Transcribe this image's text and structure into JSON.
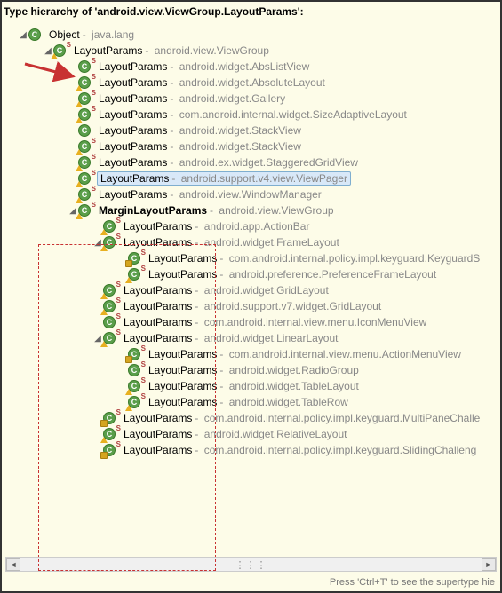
{
  "header": "Type hierarchy of 'android.view.ViewGroup.LayoutParams':",
  "footer_hint": "Press 'Ctrl+T' to see the supertype hie",
  "selected_index": 9,
  "bold_index": 11,
  "nodes": [
    {
      "indent": 0,
      "exp": "down",
      "icon": "class",
      "overlay": "",
      "name": "Object",
      "pkg": "java.lang"
    },
    {
      "indent": 1,
      "exp": "down",
      "icon": "class",
      "overlay": "warn",
      "badge": "S",
      "name": "LayoutParams",
      "pkg": "android.view.ViewGroup"
    },
    {
      "indent": 2,
      "exp": "none",
      "icon": "class",
      "overlay": "",
      "badge": "S",
      "name": "LayoutParams",
      "pkg": "android.widget.AbsListView"
    },
    {
      "indent": 2,
      "exp": "none",
      "icon": "class",
      "overlay": "warn",
      "badge": "S",
      "name": "LayoutParams",
      "pkg": "android.widget.AbsoluteLayout"
    },
    {
      "indent": 2,
      "exp": "none",
      "icon": "class",
      "overlay": "warn",
      "badge": "S",
      "name": "LayoutParams",
      "pkg": "android.widget.Gallery"
    },
    {
      "indent": 2,
      "exp": "none",
      "icon": "class",
      "overlay": "warn",
      "badge": "S",
      "name": "LayoutParams",
      "pkg": "com.android.internal.widget.SizeAdaptiveLayout"
    },
    {
      "indent": 2,
      "exp": "none",
      "icon": "class",
      "overlay": "",
      "badge": "",
      "name": "LayoutParams",
      "pkg": "android.widget.StackView"
    },
    {
      "indent": 2,
      "exp": "none",
      "icon": "class",
      "overlay": "warn",
      "badge": "S",
      "name": "LayoutParams",
      "pkg": "android.widget.StackView"
    },
    {
      "indent": 2,
      "exp": "none",
      "icon": "class",
      "overlay": "warn",
      "badge": "S",
      "name": "LayoutParams",
      "pkg": "android.ex.widget.StaggeredGridView"
    },
    {
      "indent": 2,
      "exp": "none",
      "icon": "class",
      "overlay": "warn",
      "badge": "S",
      "name": "LayoutParams",
      "pkg": "android.support.v4.view.ViewPager"
    },
    {
      "indent": 2,
      "exp": "none",
      "icon": "class",
      "overlay": "warn",
      "badge": "S",
      "name": "LayoutParams",
      "pkg": "android.view.WindowManager"
    },
    {
      "indent": 2,
      "exp": "down",
      "icon": "class",
      "overlay": "warn",
      "badge": "S",
      "name": "MarginLayoutParams",
      "pkg": "android.view.ViewGroup"
    },
    {
      "indent": 3,
      "exp": "none",
      "icon": "class",
      "overlay": "warn",
      "badge": "S",
      "name": "LayoutParams",
      "pkg": "android.app.ActionBar"
    },
    {
      "indent": 3,
      "exp": "down",
      "icon": "class",
      "overlay": "warn",
      "badge": "S",
      "name": "LayoutParams",
      "pkg": "android.widget.FrameLayout"
    },
    {
      "indent": 4,
      "exp": "none",
      "icon": "class",
      "overlay": "lock",
      "badge": "S",
      "name": "LayoutParams",
      "pkg": "com.android.internal.policy.impl.keyguard.KeyguardS"
    },
    {
      "indent": 4,
      "exp": "none",
      "icon": "class",
      "overlay": "warn",
      "badge": "S",
      "name": "LayoutParams",
      "pkg": "android.preference.PreferenceFrameLayout"
    },
    {
      "indent": 3,
      "exp": "none",
      "icon": "class",
      "overlay": "warn",
      "badge": "S",
      "name": "LayoutParams",
      "pkg": "android.widget.GridLayout"
    },
    {
      "indent": 3,
      "exp": "none",
      "icon": "class",
      "overlay": "warn",
      "badge": "S",
      "name": "LayoutParams",
      "pkg": "android.support.v7.widget.GridLayout"
    },
    {
      "indent": 3,
      "exp": "none",
      "icon": "class",
      "overlay": "",
      "badge": "S",
      "name": "LayoutParams",
      "pkg": "com.android.internal.view.menu.IconMenuView"
    },
    {
      "indent": 3,
      "exp": "down",
      "icon": "class",
      "overlay": "warn",
      "badge": "S",
      "name": "LayoutParams",
      "pkg": "android.widget.LinearLayout"
    },
    {
      "indent": 4,
      "exp": "none",
      "icon": "class",
      "overlay": "lock",
      "badge": "S",
      "name": "LayoutParams",
      "pkg": "com.android.internal.view.menu.ActionMenuView"
    },
    {
      "indent": 4,
      "exp": "none",
      "icon": "class",
      "overlay": "",
      "badge": "S",
      "name": "LayoutParams",
      "pkg": "android.widget.RadioGroup"
    },
    {
      "indent": 4,
      "exp": "none",
      "icon": "class",
      "overlay": "warn",
      "badge": "S",
      "name": "LayoutParams",
      "pkg": "android.widget.TableLayout"
    },
    {
      "indent": 4,
      "exp": "none",
      "icon": "class",
      "overlay": "warn",
      "badge": "S",
      "name": "LayoutParams",
      "pkg": "android.widget.TableRow"
    },
    {
      "indent": 3,
      "exp": "none",
      "icon": "class",
      "overlay": "lock",
      "badge": "S",
      "name": "LayoutParams",
      "pkg": "com.android.internal.policy.impl.keyguard.MultiPaneChalle"
    },
    {
      "indent": 3,
      "exp": "none",
      "icon": "class",
      "overlay": "warn",
      "badge": "S",
      "name": "LayoutParams",
      "pkg": "android.widget.RelativeLayout"
    },
    {
      "indent": 3,
      "exp": "none",
      "icon": "class",
      "overlay": "lock",
      "badge": "S",
      "name": "LayoutParams",
      "pkg": "com.android.internal.policy.impl.keyguard.SlidingChalleng"
    }
  ]
}
